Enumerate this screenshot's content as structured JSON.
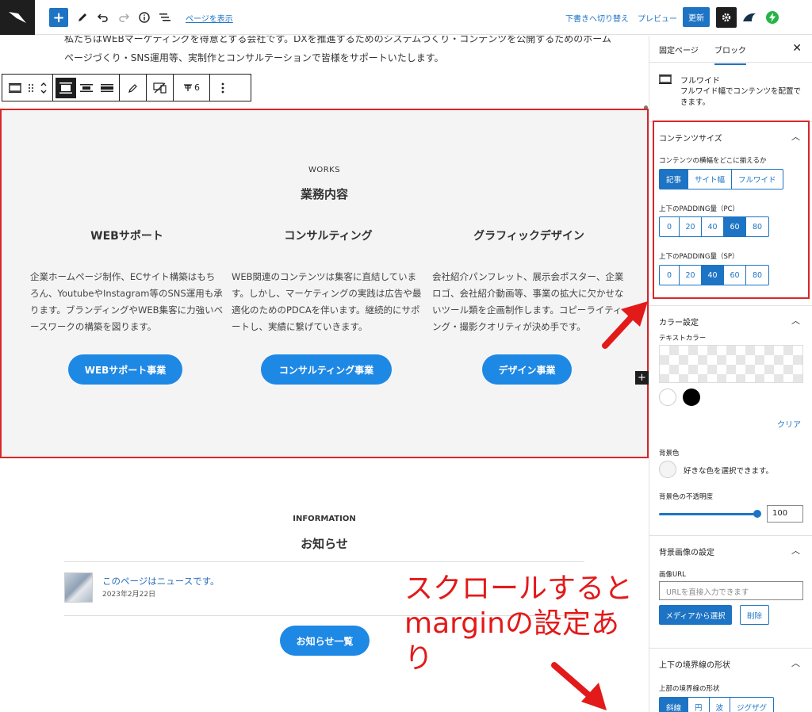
{
  "topbar": {
    "view_page": "ページを表示",
    "switch_to_draft": "下書きへ切り替え",
    "preview": "プレビュー",
    "update": "更新"
  },
  "canvas": {
    "intro_text": "私たちはWEBマーケティングを得意とする会社です。DXを推進するためのシステムづくり・コンテンツを公開するためのホームページづくり・SNS運用等、実制作とコンサルテーションで皆様をサポートいたします。",
    "toolbar": {
      "padding_label": "6"
    },
    "works": {
      "eyebrow": "WORKS",
      "title": "業務内容",
      "columns": [
        {
          "heading": "WEBサポート",
          "body": "企業ホームページ制作、ECサイト構築はもちろん、YoutubeやInstagram等のSNS運用も承ります。ブランディングやWEB集客に力強いベースワークの構築を図ります。",
          "button": "WEBサポート事業"
        },
        {
          "heading": "コンサルティング",
          "body": "WEB関連のコンテンツは集客に直結しています。しかし、マーケティングの実践は広告や最適化のためのPDCAを伴います。継続的にサポートし、実績に繋げていきます。",
          "button": "コンサルティング事業"
        },
        {
          "heading": "グラフィックデザイン",
          "body": "会社紹介パンフレット、展示会ポスター、企業ロゴ、会社紹介動画等、事業の拡大に欠かせないツール類を企画制作します。コピーライティング・撮影クオリティが決め手です。",
          "button": "デザイン事業"
        }
      ]
    },
    "information": {
      "eyebrow": "INFORMATION",
      "title": "お知らせ",
      "news": [
        {
          "title": "このページはニュースです。",
          "date": "2023年2月22日"
        }
      ],
      "button": "お知らせ一覧"
    },
    "annotation": [
      "スクロールすると",
      "marginの設定あり"
    ]
  },
  "sidebar": {
    "tabs": [
      "固定ページ",
      "ブロック"
    ],
    "block": {
      "name": "フルワイド",
      "description": "フルワイド幅でコンテンツを配置できます。"
    },
    "content_size": {
      "title": "コンテンツサイズ",
      "align_label": "コンテンツの横幅をどこに揃えるか",
      "align_options": [
        "記事",
        "サイト幅",
        "フルワイド"
      ],
      "align_selected": "記事",
      "padding_pc_label": "上下のPADDING量（PC）",
      "padding_pc_options": [
        "0",
        "20",
        "40",
        "60",
        "80"
      ],
      "padding_pc_selected": "60",
      "padding_sp_label": "上下のPADDING量（SP）",
      "padding_sp_options": [
        "0",
        "20",
        "40",
        "60",
        "80"
      ],
      "padding_sp_selected": "40"
    },
    "color": {
      "title": "カラー設定",
      "text_color_label": "テキストカラー",
      "clear": "クリア",
      "bg_label": "背景色",
      "bg_hint": "好きな色を選択できます。",
      "opacity_label": "背景色の不透明度",
      "opacity_value": "100",
      "opacity_fraction": 1.0
    },
    "bg_image": {
      "title": "背景画像の設定",
      "url_label": "画像URL",
      "url_placeholder": "URLを直接入力できます",
      "media_button": "メディアから選択",
      "delete_button": "削除"
    },
    "border": {
      "title": "上下の境界線の形状",
      "top_label": "上部の境界線の形状",
      "options": [
        "斜線",
        "円",
        "波",
        "ジグザグ"
      ],
      "selected": "斜線"
    }
  },
  "colors": {
    "accent": "#1e74c4",
    "button": "#1e88e5",
    "highlight": "#d9262a",
    "section_bg": "#f4f4f5"
  }
}
